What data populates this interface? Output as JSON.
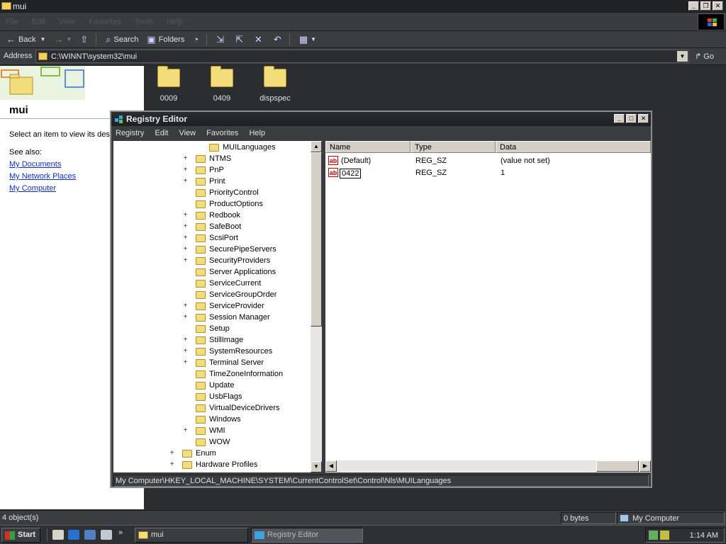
{
  "explorer": {
    "title": "mui",
    "menu": [
      "File",
      "Edit",
      "View",
      "Favorites",
      "Tools",
      "Help"
    ],
    "toolbar": {
      "back": "Back",
      "search": "Search",
      "folders": "Folders"
    },
    "address": {
      "label": "Address",
      "value": "C:\\WINNT\\system32\\mui",
      "go": "Go"
    },
    "left_pane": {
      "heading": "mui",
      "hint": "Select an item to view its desc",
      "see_also": "See also:",
      "links": [
        "My Documents",
        "My Network Places",
        "My Computer"
      ]
    },
    "folders": [
      "0009",
      "0409",
      "dispspec"
    ],
    "status": {
      "objects": "4 object(s)",
      "size": "0 bytes",
      "zone": "My Computer"
    }
  },
  "regedit": {
    "title": "Registry Editor",
    "menu": [
      "Registry",
      "Edit",
      "View",
      "Favorites",
      "Help"
    ],
    "tree": [
      {
        "label": "MUILanguages",
        "indent": 2,
        "expander": ""
      },
      {
        "label": "NTMS",
        "indent": 1,
        "expander": "+"
      },
      {
        "label": "PnP",
        "indent": 1,
        "expander": "+"
      },
      {
        "label": "Print",
        "indent": 1,
        "expander": "+"
      },
      {
        "label": "PriorityControl",
        "indent": 1,
        "expander": ""
      },
      {
        "label": "ProductOptions",
        "indent": 1,
        "expander": ""
      },
      {
        "label": "Redbook",
        "indent": 1,
        "expander": "+"
      },
      {
        "label": "SafeBoot",
        "indent": 1,
        "expander": "+"
      },
      {
        "label": "ScsiPort",
        "indent": 1,
        "expander": "+"
      },
      {
        "label": "SecurePipeServers",
        "indent": 1,
        "expander": "+"
      },
      {
        "label": "SecurityProviders",
        "indent": 1,
        "expander": "+"
      },
      {
        "label": "Server Applications",
        "indent": 1,
        "expander": ""
      },
      {
        "label": "ServiceCurrent",
        "indent": 1,
        "expander": ""
      },
      {
        "label": "ServiceGroupOrder",
        "indent": 1,
        "expander": ""
      },
      {
        "label": "ServiceProvider",
        "indent": 1,
        "expander": "+"
      },
      {
        "label": "Session Manager",
        "indent": 1,
        "expander": "+"
      },
      {
        "label": "Setup",
        "indent": 1,
        "expander": ""
      },
      {
        "label": "StillImage",
        "indent": 1,
        "expander": "+"
      },
      {
        "label": "SystemResources",
        "indent": 1,
        "expander": "+"
      },
      {
        "label": "Terminal Server",
        "indent": 1,
        "expander": "+"
      },
      {
        "label": "TimeZoneInformation",
        "indent": 1,
        "expander": ""
      },
      {
        "label": "Update",
        "indent": 1,
        "expander": ""
      },
      {
        "label": "UsbFlags",
        "indent": 1,
        "expander": ""
      },
      {
        "label": "VirtualDeviceDrivers",
        "indent": 1,
        "expander": ""
      },
      {
        "label": "Windows",
        "indent": 1,
        "expander": ""
      },
      {
        "label": "WMI",
        "indent": 1,
        "expander": "+"
      },
      {
        "label": "WOW",
        "indent": 1,
        "expander": ""
      },
      {
        "label": "Enum",
        "indent": 0,
        "expander": "+"
      },
      {
        "label": "Hardware Profiles",
        "indent": 0,
        "expander": "+"
      }
    ],
    "columns": [
      "Name",
      "Type",
      "Data"
    ],
    "values": [
      {
        "name": "(Default)",
        "type": "REG_SZ",
        "data": "(value not set)",
        "selected": false
      },
      {
        "name": "0422",
        "type": "REG_SZ",
        "data": "1",
        "selected": true
      }
    ],
    "status_path": "My Computer\\HKEY_LOCAL_MACHINE\\SYSTEM\\CurrentControlSet\\Control\\Nls\\MUILanguages"
  },
  "taskbar": {
    "start": "Start",
    "tasks": [
      {
        "label": "mui",
        "active": false
      },
      {
        "label": "Registry Editor",
        "active": true
      }
    ],
    "clock": "1:14 AM"
  }
}
